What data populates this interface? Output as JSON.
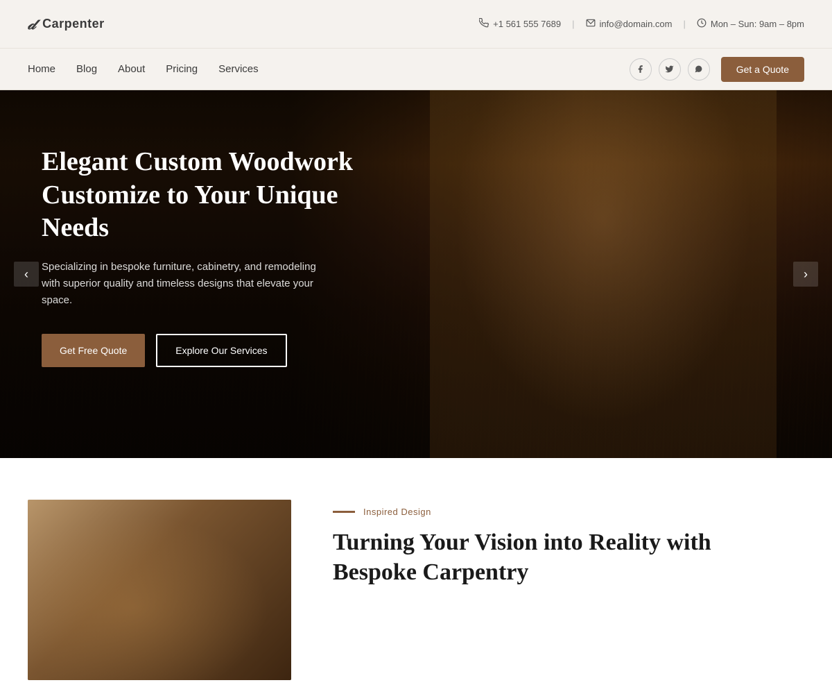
{
  "topbar": {
    "logo_icon": "𝒹",
    "logo_text": "Carpenter",
    "phone_icon": "📞",
    "phone": "+1 561 555 7689",
    "email_icon": "✉",
    "email": "info@domain.com",
    "hours_icon": "🕐",
    "hours": "Mon – Sun: 9am – 8pm"
  },
  "nav": {
    "links": [
      {
        "label": "Home",
        "key": "home"
      },
      {
        "label": "Blog",
        "key": "blog"
      },
      {
        "label": "About",
        "key": "about"
      },
      {
        "label": "Pricing",
        "key": "pricing"
      },
      {
        "label": "Services",
        "key": "services"
      }
    ],
    "social": [
      {
        "icon": "f",
        "name": "facebook"
      },
      {
        "icon": "t",
        "name": "twitter"
      },
      {
        "icon": "w",
        "name": "whatsapp"
      }
    ],
    "quote_button": "Get a Quote"
  },
  "hero": {
    "title": "Elegant Custom Woodwork Customize to Your Unique Needs",
    "subtitle": "Specializing in bespoke furniture, cabinetry, and remodeling with superior quality and timeless designs that elevate your space.",
    "btn_primary": "Get Free Quote",
    "btn_secondary": "Explore Our Services",
    "arrow_left": "‹",
    "arrow_right": "›"
  },
  "below": {
    "section_label": "Inspired Design",
    "title_line1": "Turning Your Vision into Reality with",
    "title_line2": "Bespoke Carpentry"
  }
}
